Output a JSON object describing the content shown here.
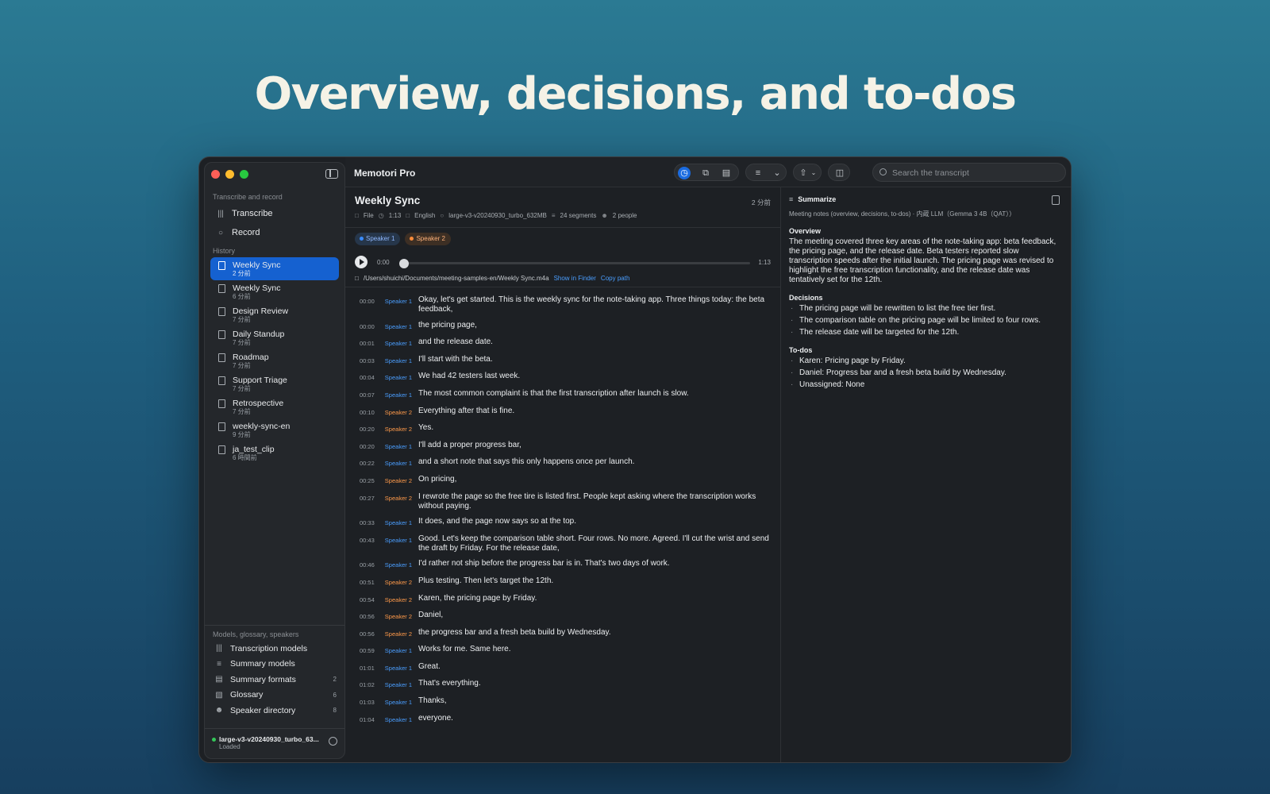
{
  "hero_title": "Overview, decisions, and to-dos",
  "app": {
    "title": "Memotori Pro"
  },
  "search": {
    "placeholder": "Search the transcript"
  },
  "sidebar": {
    "section1": "Transcribe and record",
    "actions": [
      {
        "label": "Transcribe",
        "icon": "waveform-icon"
      },
      {
        "label": "Record",
        "icon": "mic-icon"
      }
    ],
    "history_header": "History",
    "history": [
      {
        "title": "Weekly Sync",
        "time": "2 分前",
        "selected": true
      },
      {
        "title": "Weekly Sync",
        "time": "6 分前"
      },
      {
        "title": "Design Review",
        "time": "7 分前"
      },
      {
        "title": "Daily Standup",
        "time": "7 分前"
      },
      {
        "title": "Roadmap",
        "time": "7 分前"
      },
      {
        "title": "Support Triage",
        "time": "7 分前"
      },
      {
        "title": "Retrospective",
        "time": "7 分前"
      },
      {
        "title": "weekly-sync-en",
        "time": "9 分前"
      },
      {
        "title": "ja_test_clip",
        "time": "6 時間前"
      }
    ],
    "bottom_header": "Models, glossary, speakers",
    "bottom_items": [
      {
        "label": "Transcription models",
        "count": ""
      },
      {
        "label": "Summary models",
        "count": ""
      },
      {
        "label": "Summary formats",
        "count": "2"
      },
      {
        "label": "Glossary",
        "count": "6"
      },
      {
        "label": "Speaker directory",
        "count": "8"
      }
    ],
    "model": {
      "name": "large-v3-v20240930_turbo_63...",
      "status": "Loaded"
    }
  },
  "recording": {
    "title": "Weekly Sync",
    "time_ago": "2 分前",
    "meta": {
      "source": "File",
      "duration": "1:13",
      "language": "English",
      "model": "large-v3-v20240930_turbo_632MB",
      "segments": "24 segments",
      "people": "2 people"
    },
    "speakers": [
      "Speaker 1",
      "Speaker 2"
    ],
    "player": {
      "current": "0:00",
      "total": "1:13",
      "progress": 0
    },
    "path": "/Users/shuichi/Documents/meeting-samples-en/Weekly Sync.m4a",
    "show_in_finder": "Show in Finder",
    "copy_path": "Copy path"
  },
  "segments": [
    {
      "t": "00:00",
      "sp": "Speaker 1",
      "s": 1,
      "text": "Okay, let's get started. This is the weekly sync for the note-taking app. Three things today: the beta feedback,"
    },
    {
      "t": "00:00",
      "sp": "Speaker 1",
      "s": 1,
      "text": "the pricing page,"
    },
    {
      "t": "00:01",
      "sp": "Speaker 1",
      "s": 1,
      "text": "and the release date."
    },
    {
      "t": "00:03",
      "sp": "Speaker 1",
      "s": 1,
      "text": "I'll start with the beta."
    },
    {
      "t": "00:04",
      "sp": "Speaker 1",
      "s": 1,
      "text": "We had 42 testers last week."
    },
    {
      "t": "00:07",
      "sp": "Speaker 1",
      "s": 1,
      "text": "The most common complaint is that the first transcription after launch is slow."
    },
    {
      "t": "00:10",
      "sp": "Speaker 2",
      "s": 2,
      "text": "Everything after that is fine."
    },
    {
      "t": "00:20",
      "sp": "Speaker 2",
      "s": 2,
      "text": "Yes."
    },
    {
      "t": "00:20",
      "sp": "Speaker 1",
      "s": 1,
      "text": "I'll add a proper progress bar,"
    },
    {
      "t": "00:22",
      "sp": "Speaker 1",
      "s": 1,
      "text": "and a short note that says this only happens once per launch."
    },
    {
      "t": "00:25",
      "sp": "Speaker 2",
      "s": 2,
      "text": "On pricing,"
    },
    {
      "t": "00:27",
      "sp": "Speaker 2",
      "s": 2,
      "text": "I rewrote the page so the free tire is listed first. People kept asking where the transcription works without paying."
    },
    {
      "t": "00:33",
      "sp": "Speaker 1",
      "s": 1,
      "text": "It does, and the page now says so at the top."
    },
    {
      "t": "00:43",
      "sp": "Speaker 1",
      "s": 1,
      "text": "Good. Let's keep the comparison table short. Four rows. No more. Agreed. I'll cut the wrist and send the draft by Friday. For the release date,"
    },
    {
      "t": "00:46",
      "sp": "Speaker 1",
      "s": 1,
      "text": "I'd rather not ship before the progress bar is in. That's two days of work."
    },
    {
      "t": "00:51",
      "sp": "Speaker 2",
      "s": 2,
      "text": "Plus testing. Then let's target the 12th."
    },
    {
      "t": "00:54",
      "sp": "Speaker 2",
      "s": 2,
      "text": "Karen, the pricing page by Friday."
    },
    {
      "t": "00:56",
      "sp": "Speaker 2",
      "s": 2,
      "text": "Daniel,"
    },
    {
      "t": "00:56",
      "sp": "Speaker 2",
      "s": 2,
      "text": "the progress bar and a fresh beta build by Wednesday."
    },
    {
      "t": "00:59",
      "sp": "Speaker 1",
      "s": 1,
      "text": "Works for me. Same here."
    },
    {
      "t": "01:01",
      "sp": "Speaker 1",
      "s": 1,
      "text": "Great."
    },
    {
      "t": "01:02",
      "sp": "Speaker 1",
      "s": 1,
      "text": "That's everything."
    },
    {
      "t": "01:03",
      "sp": "Speaker 1",
      "s": 1,
      "text": "Thanks,"
    },
    {
      "t": "01:04",
      "sp": "Speaker 1",
      "s": 1,
      "text": "everyone."
    }
  ],
  "summary": {
    "header": "Summarize",
    "subtitle": "Meeting notes (overview, decisions, to-dos) · 内蔵 LLM（Gemma 3 4B（QAT））",
    "overview_h": "Overview",
    "overview": "The meeting covered three key areas of the note-taking app: beta feedback, the pricing page, and the release date. Beta testers reported slow transcription speeds after the initial launch. The pricing page was revised to highlight the free transcription functionality, and the release date was tentatively set for the 12th.",
    "decisions_h": "Decisions",
    "decisions": [
      "The pricing page will be rewritten to list the free tier first.",
      "The comparison table on the pricing page will be limited to four rows.",
      "The release date will be targeted for the 12th."
    ],
    "todos_h": "To-dos",
    "todos": [
      "Karen: Pricing page by Friday.",
      "Daniel: Progress bar and a fresh beta build by Wednesday.",
      "Unassigned: None"
    ]
  },
  "colors": {
    "accent": "#1561d0",
    "speaker1": "#4a9eff",
    "speaker2": "#ff9a4a"
  }
}
